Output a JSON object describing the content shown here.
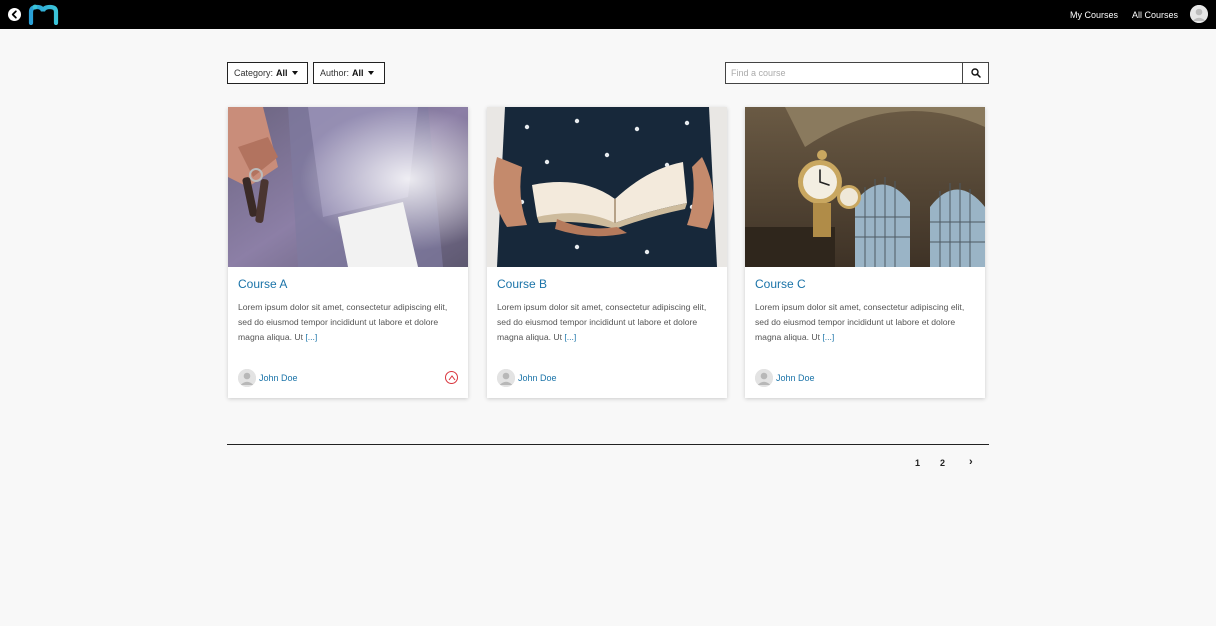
{
  "header": {
    "nav": [
      "My Courses",
      "All Courses"
    ]
  },
  "filters": {
    "category_label": "Category:",
    "category_value": "All",
    "author_label": "Author:",
    "author_value": "All"
  },
  "search": {
    "placeholder": "Find a course"
  },
  "courses": [
    {
      "title": "Course A",
      "description": "Lorem ipsum dolor sit amet, consectetur adipiscing elit, sed do eiusmod tempor incididunt ut labore et dolore magna aliqua. Ut",
      "more": "[...]",
      "author": "John Doe"
    },
    {
      "title": "Course B",
      "description": "Lorem ipsum dolor sit amet, consectetur adipiscing elit, sed do eiusmod tempor incididunt ut labore et dolore magna aliqua. Ut",
      "more": "[...]",
      "author": "John Doe"
    },
    {
      "title": "Course C",
      "description": "Lorem ipsum dolor sit amet, consectetur adipiscing elit, sed do eiusmod tempor incididunt ut labore et dolore magna aliqua. Ut",
      "more": "[...]",
      "author": "John Doe"
    }
  ],
  "pagination": {
    "pages": [
      "1",
      "2"
    ],
    "next": "›"
  },
  "colors": {
    "accent": "#1a73a8",
    "topbar": "#000000",
    "badge": "#d9363e"
  },
  "icons": [
    "back-arrow-icon",
    "moodle-logo",
    "user-avatar-icon",
    "search-icon",
    "caret-down-icon",
    "badge-icon"
  ]
}
